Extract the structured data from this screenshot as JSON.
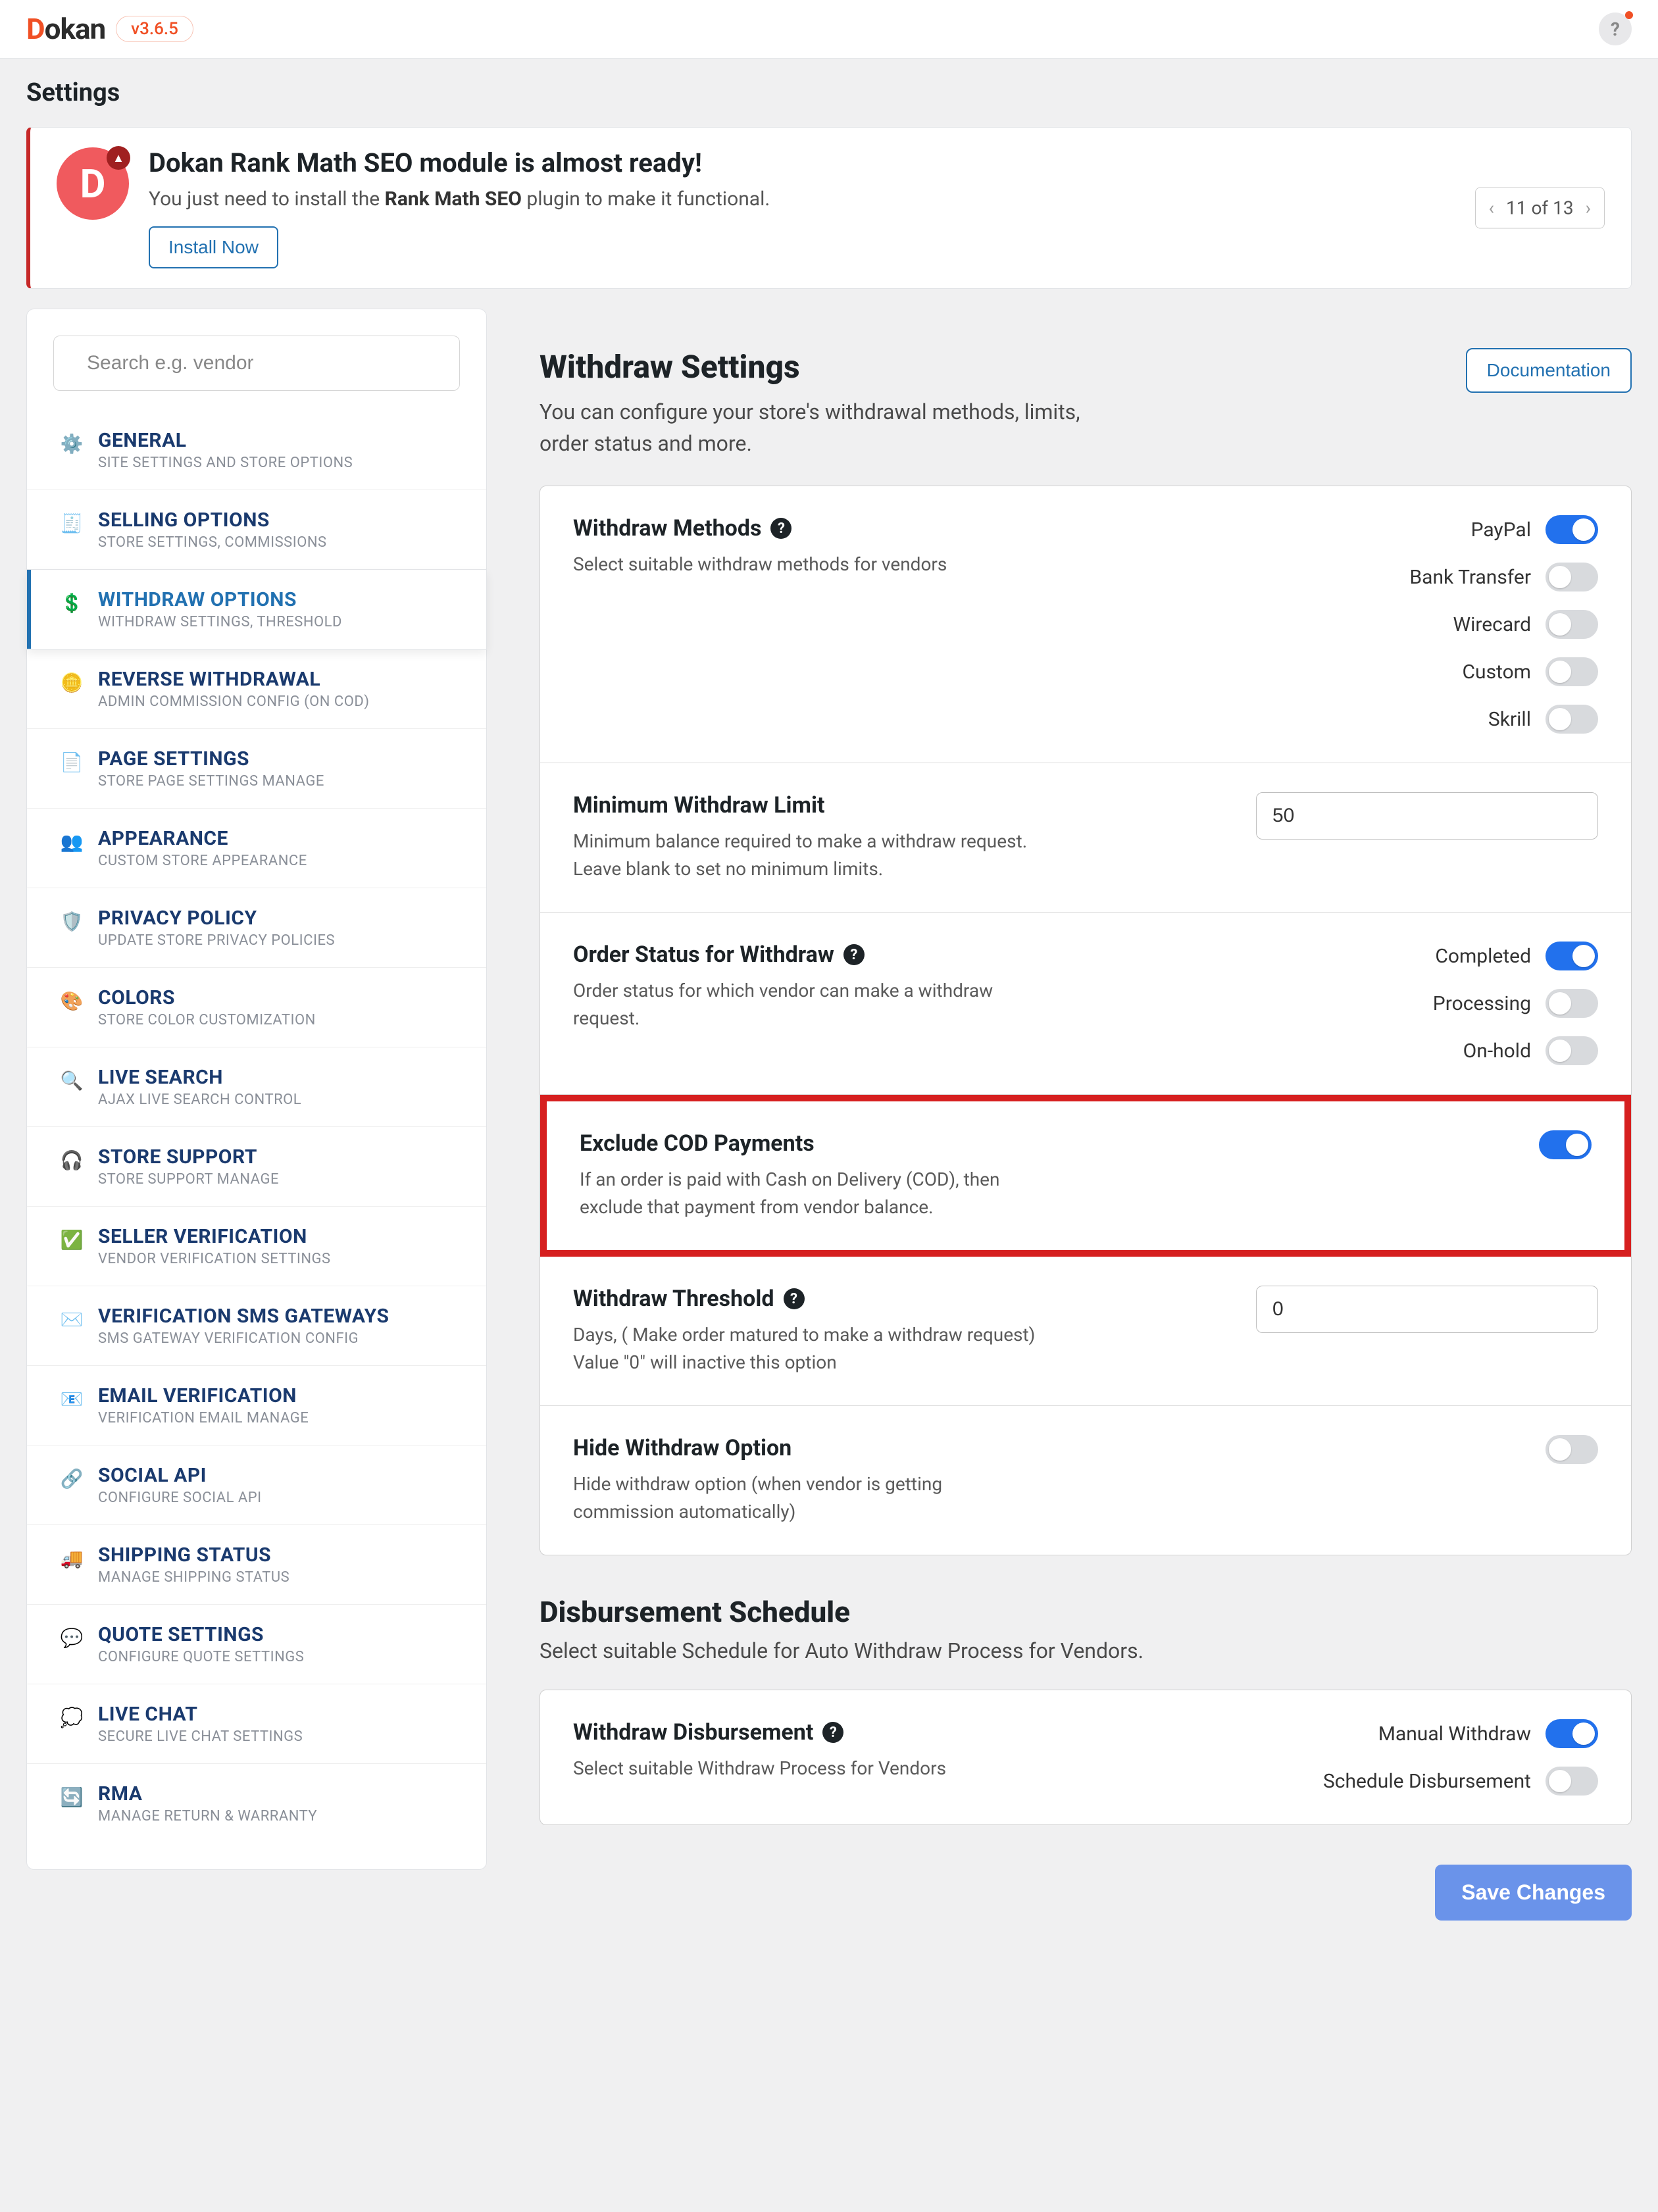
{
  "brand": {
    "letter": "D",
    "rest": "okan",
    "version": "v3.6.5"
  },
  "help_glyph": "?",
  "page_title": "Settings",
  "notice": {
    "badge_letter": "D",
    "title": "Dokan Rank Math SEO module is almost ready!",
    "pre_text": "You just need to install the ",
    "bold_text": "Rank Math SEO",
    "post_text": " plugin to make it functional.",
    "install_btn": "Install Now",
    "pager": {
      "text": "11 of 13",
      "prev": "‹",
      "next": "›"
    }
  },
  "search": {
    "placeholder": "Search e.g. vendor"
  },
  "nav": [
    {
      "icon": "⚙️",
      "label": "GENERAL",
      "desc": "SITE SETTINGS AND STORE OPTIONS",
      "name": "nav-general"
    },
    {
      "icon": "🧾",
      "label": "SELLING OPTIONS",
      "desc": "STORE SETTINGS, COMMISSIONS",
      "name": "nav-selling"
    },
    {
      "icon": "💲",
      "label": "WITHDRAW OPTIONS",
      "desc": "WITHDRAW SETTINGS, THRESHOLD",
      "name": "nav-withdraw",
      "active": true
    },
    {
      "icon": "🪙",
      "label": "REVERSE WITHDRAWAL",
      "desc": "ADMIN COMMISSION CONFIG (ON COD)",
      "name": "nav-reverse"
    },
    {
      "icon": "📄",
      "label": "PAGE SETTINGS",
      "desc": "STORE PAGE SETTINGS MANAGE",
      "name": "nav-page"
    },
    {
      "icon": "👥",
      "label": "APPEARANCE",
      "desc": "CUSTOM STORE APPEARANCE",
      "name": "nav-appearance"
    },
    {
      "icon": "🛡️",
      "label": "PRIVACY POLICY",
      "desc": "UPDATE STORE PRIVACY POLICIES",
      "name": "nav-privacy"
    },
    {
      "icon": "🎨",
      "label": "COLORS",
      "desc": "STORE COLOR CUSTOMIZATION",
      "name": "nav-colors"
    },
    {
      "icon": "🔍",
      "label": "LIVE SEARCH",
      "desc": "AJAX LIVE SEARCH CONTROL",
      "name": "nav-livesearch"
    },
    {
      "icon": "🎧",
      "label": "STORE SUPPORT",
      "desc": "STORE SUPPORT MANAGE",
      "name": "nav-support"
    },
    {
      "icon": "✅",
      "label": "SELLER VERIFICATION",
      "desc": "VENDOR VERIFICATION SETTINGS",
      "name": "nav-sellerverif"
    },
    {
      "icon": "✉️",
      "label": "VERIFICATION SMS GATEWAYS",
      "desc": "SMS GATEWAY VERIFICATION CONFIG",
      "name": "nav-sms"
    },
    {
      "icon": "📧",
      "label": "EMAIL VERIFICATION",
      "desc": "VERIFICATION EMAIL MANAGE",
      "name": "nav-emailverif"
    },
    {
      "icon": "🔗",
      "label": "SOCIAL API",
      "desc": "CONFIGURE SOCIAL API",
      "name": "nav-social"
    },
    {
      "icon": "🚚",
      "label": "SHIPPING STATUS",
      "desc": "MANAGE SHIPPING STATUS",
      "name": "nav-shipping"
    },
    {
      "icon": "💬",
      "label": "QUOTE SETTINGS",
      "desc": "CONFIGURE QUOTE SETTINGS",
      "name": "nav-quote"
    },
    {
      "icon": "💭",
      "label": "LIVE CHAT",
      "desc": "SECURE LIVE CHAT SETTINGS",
      "name": "nav-livechat"
    },
    {
      "icon": "🔄",
      "label": "RMA",
      "desc": "MANAGE RETURN & WARRANTY",
      "name": "nav-rma"
    }
  ],
  "header": {
    "title": "Withdraw Settings",
    "desc": "You can configure your store's withdrawal methods, limits, order status and more.",
    "doc_btn": "Documentation"
  },
  "withdraw_methods": {
    "title": "Withdraw Methods",
    "desc": "Select suitable withdraw methods for vendors",
    "options": [
      {
        "label": "PayPal",
        "on": true
      },
      {
        "label": "Bank Transfer",
        "on": false
      },
      {
        "label": "Wirecard",
        "on": false
      },
      {
        "label": "Custom",
        "on": false
      },
      {
        "label": "Skrill",
        "on": false
      }
    ]
  },
  "min_limit": {
    "title": "Minimum Withdraw Limit",
    "desc": "Minimum balance required to make a withdraw request. Leave blank to set no minimum limits.",
    "value": "50"
  },
  "order_status": {
    "title": "Order Status for Withdraw",
    "desc": "Order status for which vendor can make a withdraw request.",
    "options": [
      {
        "label": "Completed",
        "on": true
      },
      {
        "label": "Processing",
        "on": false
      },
      {
        "label": "On-hold",
        "on": false
      }
    ]
  },
  "exclude_cod": {
    "title": "Exclude COD Payments",
    "desc": "If an order is paid with Cash on Delivery (COD), then exclude that payment from vendor balance.",
    "on": true
  },
  "threshold": {
    "title": "Withdraw Threshold",
    "desc": "Days, ( Make order matured to make a withdraw request) Value \"0\" will inactive this option",
    "value": "0"
  },
  "hide_option": {
    "title": "Hide Withdraw Option",
    "desc": "Hide withdraw option (when vendor is getting commission automatically)",
    "on": false
  },
  "disbursement": {
    "title": "Disbursement Schedule",
    "desc": "Select suitable Schedule for Auto Withdraw Process for Vendors.",
    "row_title": "Withdraw Disbursement",
    "row_desc": "Select suitable Withdraw Process for Vendors",
    "options": [
      {
        "label": "Manual Withdraw",
        "on": true
      },
      {
        "label": "Schedule Disbursement",
        "on": false
      }
    ]
  },
  "save_btn": "Save Changes",
  "help_char": "?"
}
